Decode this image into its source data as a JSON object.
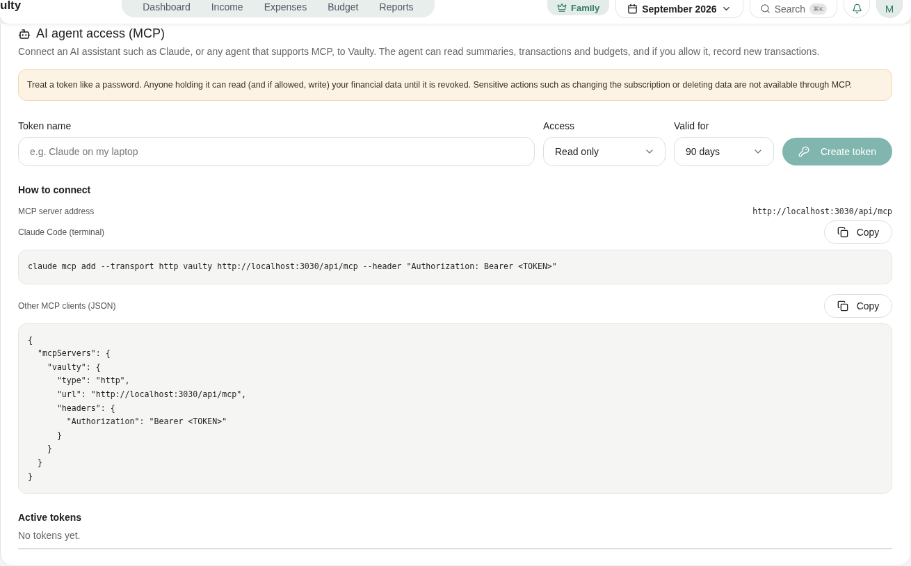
{
  "header": {
    "logo": "ulty",
    "nav": [
      {
        "label": "Dashboard",
        "selected": false
      },
      {
        "label": "Income",
        "selected": false
      },
      {
        "label": "Expenses",
        "selected": false
      },
      {
        "label": "Budget",
        "selected": false
      },
      {
        "label": "Reports",
        "selected": false
      }
    ],
    "plan_badge": "Family",
    "month": "September 2026",
    "search": {
      "label": "Search",
      "shortcut": "⌘K"
    },
    "avatar": "M"
  },
  "section": {
    "title": "AI agent access (MCP)",
    "description": "Connect an AI assistant such as Claude, or any agent that supports MCP, to Vaulty. The agent can read summaries, transactions and budgets, and if you allow it, record new transactions.",
    "warning": "Treat a token like a password. Anyone holding it can read (and if allowed, write) your financial data until it is revoked. Sensitive actions such as changing the subscription or deleting data are not available through MCP.",
    "form": {
      "token_name": {
        "label": "Token name",
        "placeholder": "e.g. Claude on my laptop"
      },
      "access": {
        "label": "Access",
        "value": "Read only"
      },
      "valid_for": {
        "label": "Valid for",
        "value": "90 days"
      },
      "create_button": {
        "label": "Create token",
        "disabled": true
      }
    },
    "connect": {
      "title": "How to connect",
      "server_label": "MCP server address",
      "server_url": "http://localhost:3030/api/mcp",
      "snippets": [
        {
          "label": "Claude Code (terminal)",
          "copy": "Copy",
          "code": "claude mcp add --transport http vaulty http://localhost:3030/api/mcp --header \"Authorization: Bearer <TOKEN>\""
        },
        {
          "label": "Other MCP clients (JSON)",
          "copy": "Copy",
          "code": "{\n  \"mcpServers\": {\n    \"vaulty\": {\n      \"type\": \"http\",\n      \"url\": \"http://localhost:3030/api/mcp\",\n      \"headers\": {\n        \"Authorization\": \"Bearer <TOKEN>\"\n      }\n    }\n  }\n}"
        }
      ]
    },
    "tokens": {
      "title": "Active tokens",
      "empty": "No tokens yet."
    }
  }
}
